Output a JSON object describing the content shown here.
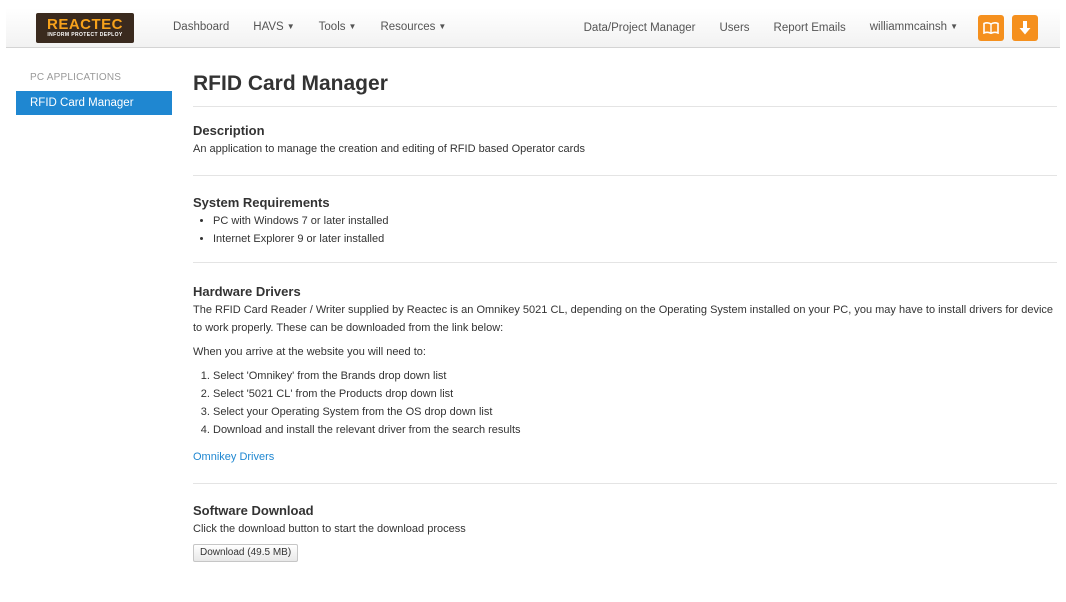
{
  "brand": {
    "name": "REACTEC",
    "tagline": "INFORM  PROTECT  DEPLOY"
  },
  "nav": {
    "left": [
      {
        "label": "Dashboard",
        "dropdown": false
      },
      {
        "label": "HAVS",
        "dropdown": true
      },
      {
        "label": "Tools",
        "dropdown": true
      },
      {
        "label": "Resources",
        "dropdown": true
      }
    ],
    "right": [
      {
        "label": "Data/Project Manager",
        "dropdown": false
      },
      {
        "label": "Users",
        "dropdown": false
      },
      {
        "label": "Report Emails",
        "dropdown": false
      },
      {
        "label": "williammcainsh",
        "dropdown": true
      }
    ],
    "icons": [
      "book-icon",
      "download-arrow-icon"
    ]
  },
  "sidebar": {
    "header": "PC APPLICATIONS",
    "items": [
      {
        "label": "RFID Card Manager",
        "active": true
      }
    ]
  },
  "main": {
    "title": "RFID Card Manager",
    "description": {
      "heading": "Description",
      "text": "An application to manage the creation and editing of RFID based Operator cards"
    },
    "requirements": {
      "heading": "System Requirements",
      "items": [
        "PC with Windows 7 or later installed",
        "Internet Explorer 9 or later installed"
      ]
    },
    "drivers": {
      "heading": "Hardware Drivers",
      "text": "The RFID Card Reader / Writer supplied by Reactec is an Omnikey 5021 CL, depending on the Operating System installed on your PC, you may have to install drivers for device to work properly. These can be downloaded from the link below:",
      "intro": "When you arrive at the website you will need to:",
      "steps": [
        "Select 'Omnikey' from the Brands drop down list",
        "Select '5021 CL' from the Products drop down list",
        "Select your Operating System from the OS drop down list",
        "Download and install the relevant driver from the search results"
      ],
      "link": "Omnikey Drivers"
    },
    "download": {
      "heading": "Software Download",
      "text": "Click the download button to start the download process",
      "button": "Download (49.5 MB)"
    }
  },
  "colors": {
    "accent": "#1f87d1",
    "brand_orange": "#f5901e",
    "brand_dark": "#3a2a1e"
  }
}
